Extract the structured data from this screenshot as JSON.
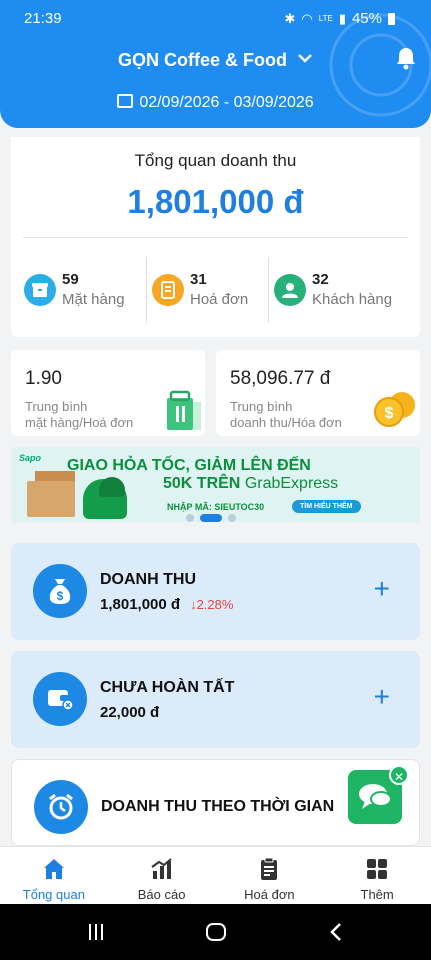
{
  "status": {
    "time": "21:39",
    "battery": "45%",
    "network": "LTE"
  },
  "header": {
    "store_name": "GỌN Coffee & Food",
    "date_range": "02/09/2026 - 03/09/2026"
  },
  "overview": {
    "title": "Tổng quan doanh thu",
    "amount": "1,801,000 đ",
    "stats": [
      {
        "value": "59",
        "label": "Mặt hàng",
        "icon": "box-icon"
      },
      {
        "value": "31",
        "label": "Hoá đơn",
        "icon": "receipt-icon"
      },
      {
        "value": "32",
        "label": "Khách hàng",
        "icon": "user-icon"
      }
    ]
  },
  "avg_items": {
    "value": "1.90",
    "label1": "Trung bình",
    "label2": "mặt hàng/Hoá đơn"
  },
  "avg_revenue": {
    "value": "58,096.77 đ",
    "label1": "Trung bình",
    "label2": "doanh thu/Hóa đơn"
  },
  "banner": {
    "brand": "Sapo",
    "line1": "GIAO HỎA TỐC, GIẢM LÊN ĐẾN",
    "line2_amount": "50K TRÊN",
    "line2_partner": "GrabExpress",
    "line3": "NHẬP MÃ: SIEUTOC30",
    "cta": "TÌM HIỂU THÊM"
  },
  "tiles": [
    {
      "title": "DOANH THU",
      "value": "1,801,000 đ",
      "change": "↓2.28%",
      "icon": "money-bag-icon"
    },
    {
      "title": "CHƯA HOÀN TẤT",
      "value": "22,000 đ",
      "icon": "wallet-cancel-icon"
    },
    {
      "title": "DOANH THU THEO THỜI GIAN",
      "icon": "alarm-clock-icon"
    }
  ],
  "tabs": [
    {
      "label": "Tổng quan",
      "active": true
    },
    {
      "label": "Báo cáo",
      "active": false
    },
    {
      "label": "Hoá đơn",
      "active": false
    },
    {
      "label": "Thêm",
      "active": false
    }
  ],
  "colors": {
    "primary": "#1e8cf0",
    "accent_blue": "#1e7fe0",
    "negative": "#e0473f",
    "chat_green": "#1db563"
  }
}
